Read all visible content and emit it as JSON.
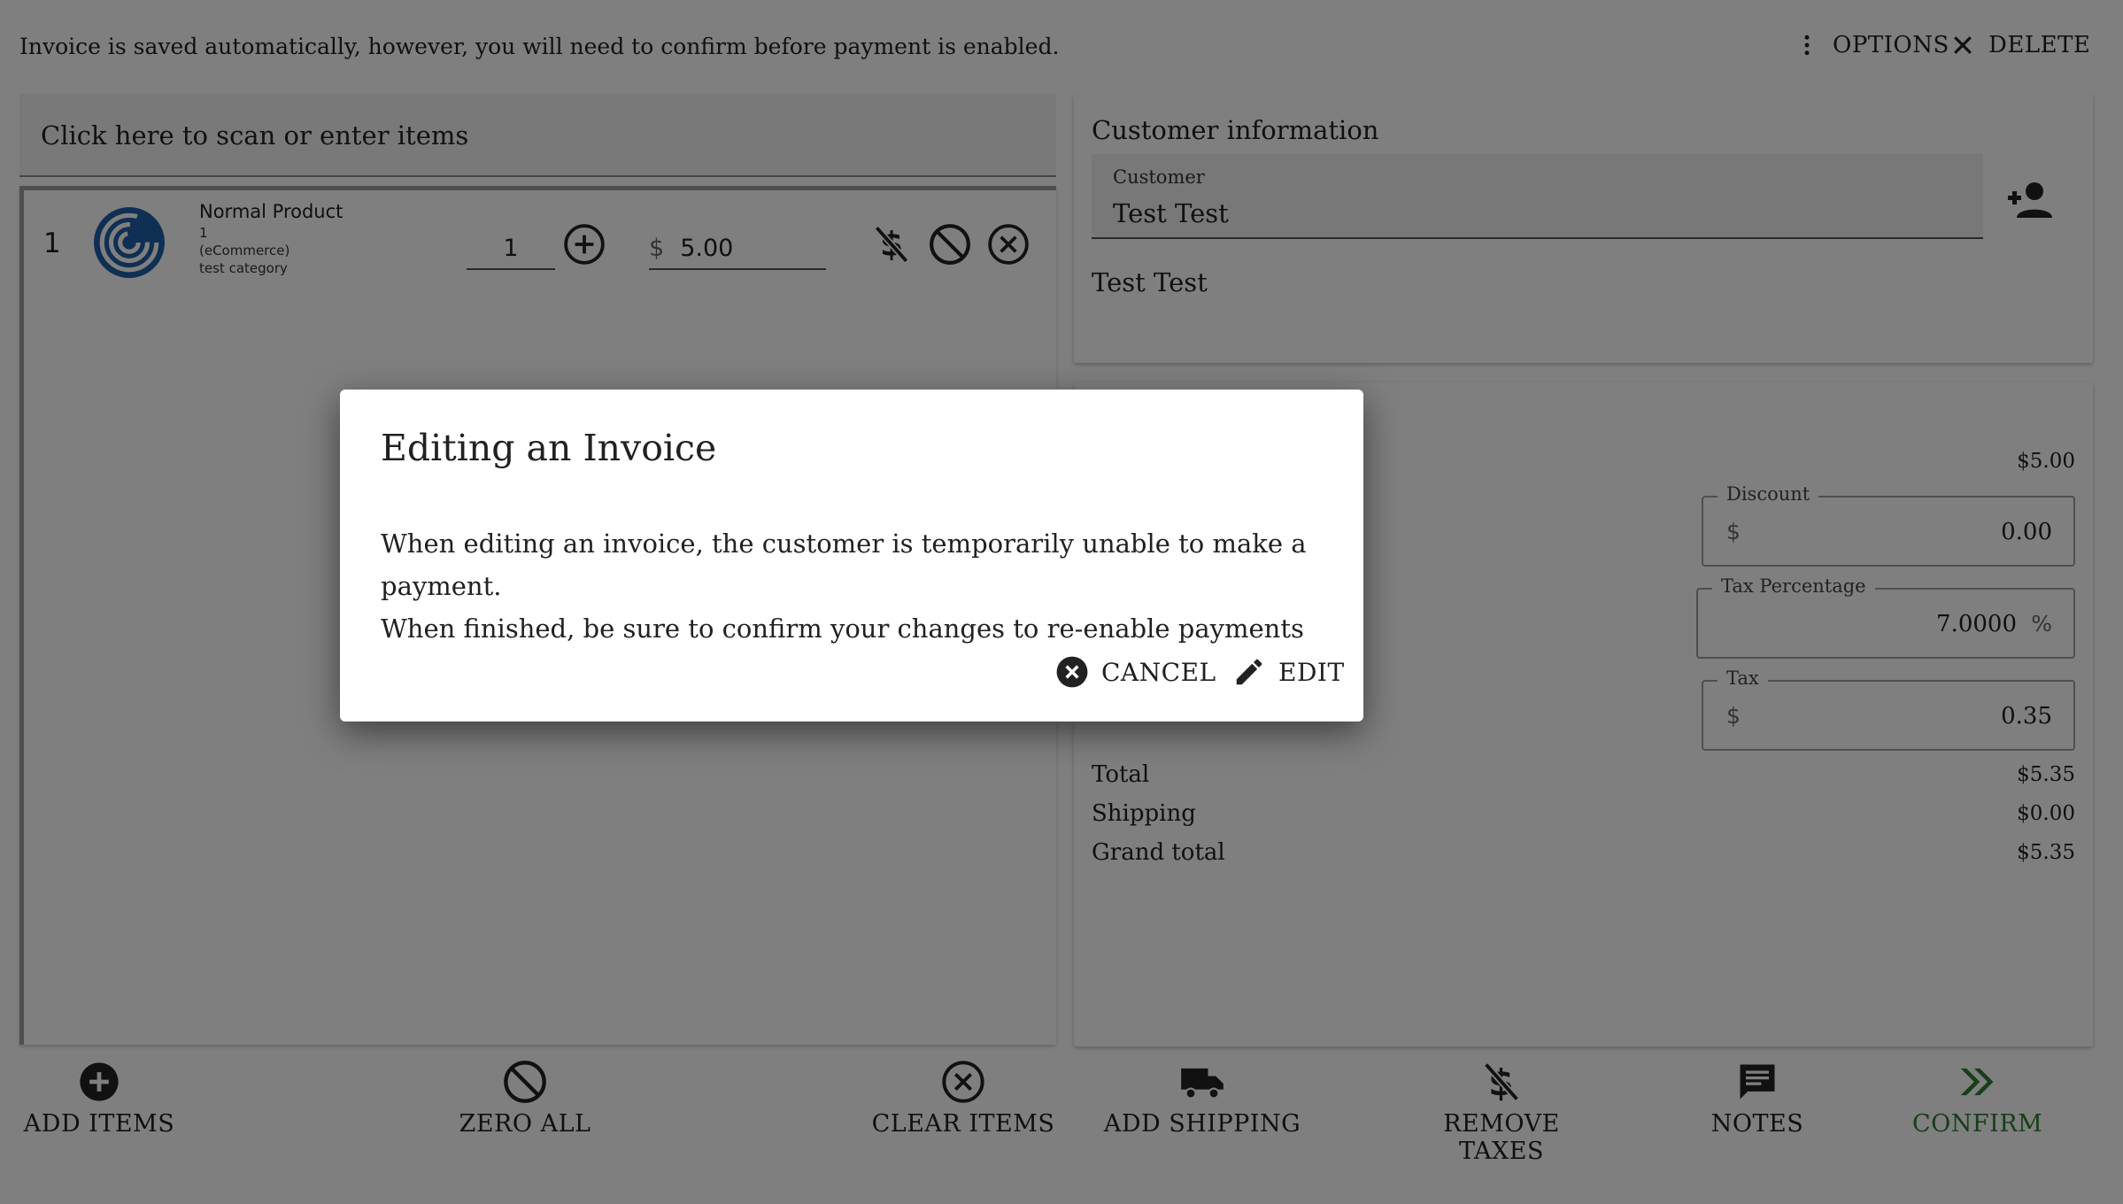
{
  "topbar": {
    "notice": "Invoice is saved automatically, however, you will need to confirm before payment is enabled.",
    "options_label": "OPTIONS",
    "delete_label": "DELETE"
  },
  "scan": {
    "prompt": "Click here to scan or enter items"
  },
  "items": [
    {
      "index": "1",
      "name": "Normal Product",
      "sub1": "1",
      "sub2": "(eCommerce)",
      "sub3": "test category",
      "quantity": "1",
      "currency": "$",
      "price": "5.00"
    }
  ],
  "customer": {
    "title": "Customer information",
    "field_label": "Customer",
    "field_value": "Test Test",
    "display_name": "Test Test"
  },
  "summary": {
    "subtotal": "$5.00",
    "discount_label": "Discount",
    "discount_prefix": "$",
    "discount_value": "0.00",
    "tax_pct_label": "Tax Percentage",
    "tax_pct_value": "7.0000",
    "tax_pct_suffix": "%",
    "tax_label": "Tax",
    "tax_prefix": "$",
    "tax_value": "0.35",
    "total_label": "Total",
    "total_value": "$5.35",
    "shipping_label": "Shipping",
    "shipping_value": "$0.00",
    "grand_label": "Grand total",
    "grand_value": "$5.35"
  },
  "bottom": {
    "add_items": "ADD ITEMS",
    "zero_all": "ZERO ALL",
    "clear_items": "CLEAR ITEMS",
    "add_shipping": "ADD SHIPPING",
    "remove_taxes": "REMOVE TAXES",
    "notes": "NOTES",
    "confirm": "CONFIRM"
  },
  "dialog": {
    "title": "Editing an Invoice",
    "body_line1": "When editing an invoice, the customer is temporarily unable to make a payment.",
    "body_line2": "When finished, be sure to confirm your changes to re-enable payments",
    "cancel_label": "CANCEL",
    "edit_label": "EDIT"
  },
  "colors": {
    "confirm": "#2e7d32",
    "logo": "#1e5fa8",
    "overlay": "rgba(0,0,0,0.5)"
  }
}
